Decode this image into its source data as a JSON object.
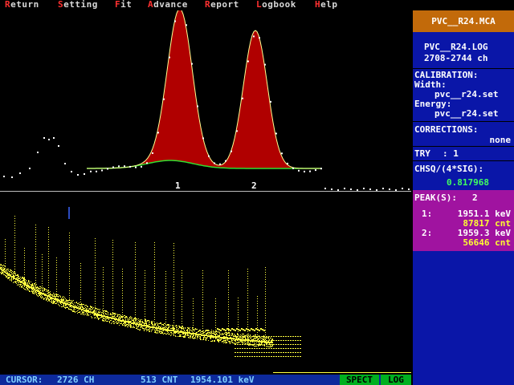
{
  "menu": [
    {
      "hot": "R",
      "rest": "eturn"
    },
    {
      "hot": "S",
      "rest": "etting"
    },
    {
      "hot": "F",
      "rest": "it"
    },
    {
      "hot": "A",
      "rest": "dvance"
    },
    {
      "hot": "R",
      "rest": "eport"
    },
    {
      "hot": "L",
      "rest": "ogbook"
    },
    {
      "hot": "H",
      "rest": "elp"
    }
  ],
  "panel": {
    "file_title": "PVC__R24.MCA",
    "log_name": "PVC__R24.LOG",
    "channel_range": "2708-2744 ch",
    "calibration_label": "CALIBRATION:",
    "width_label": "Width:",
    "width_file": "pvc__r24.set",
    "energy_label": "Energy:",
    "energy_file": "pvc__r24.set",
    "corrections_label": "CORRECTIONS:",
    "corrections_value": "none",
    "try_label": "TRY",
    "try_value": ": 1",
    "chisq_label": "CHSQ/(4*SIG):",
    "chisq_value": "0.817968"
  },
  "peaks": {
    "count_label": "PEAK(S):",
    "count": "2",
    "list": [
      {
        "index": "1:",
        "energy": "1951.1 keV",
        "counts": "87817 cnt"
      },
      {
        "index": "2:",
        "energy": "1959.3 keV",
        "counts": "56646 cnt"
      }
    ]
  },
  "fit_plot": {
    "peak_labels": [
      "1",
      "2"
    ],
    "colors": {
      "fill": "#b00000",
      "fit_line": "#ffff90",
      "background_line": "#30e030",
      "data_points": "#ffffff"
    }
  },
  "spectrum": {
    "cursor_color": "#3a64ff",
    "point_color": "#ffff40"
  },
  "status": {
    "cursor_label": "CURSOR:",
    "cursor_channel": "2726 CH",
    "counts": "513 CNT",
    "energy": "1954.101 keV"
  },
  "tabs": {
    "spect": "SPECT",
    "log": "LOG"
  }
}
